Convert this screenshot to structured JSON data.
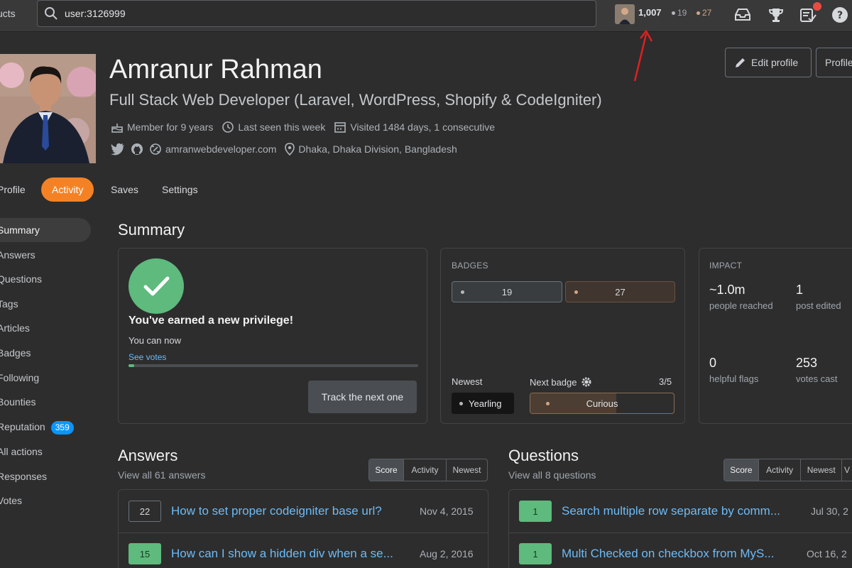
{
  "topbar": {
    "products_label": "ucts",
    "search_value": "user:3126999",
    "reputation": "1,007",
    "silver_count": "19",
    "bronze_count": "27"
  },
  "profile": {
    "name": "Amranur Rahman",
    "title": "Full Stack Web Developer (Laravel, WordPress, Shopify & CodeIgniter)",
    "member_for": "Member for 9 years",
    "last_seen": "Last seen this week",
    "visited": "Visited 1484 days, 1 consecutive",
    "website": "amranwebdeveloper.com",
    "location": "Dhaka, Dhaka Division, Bangladesh",
    "edit_profile_label": "Edit profile",
    "profiles_label": "Profile"
  },
  "tabs": [
    {
      "label": "Profile"
    },
    {
      "label": "Activity"
    },
    {
      "label": "Saves"
    },
    {
      "label": "Settings"
    }
  ],
  "sidebar": [
    {
      "label": "Summary"
    },
    {
      "label": "Answers"
    },
    {
      "label": "Questions"
    },
    {
      "label": "Tags"
    },
    {
      "label": "Articles"
    },
    {
      "label": "Badges"
    },
    {
      "label": "Following"
    },
    {
      "label": "Bounties"
    },
    {
      "label": "Reputation",
      "count": "359"
    },
    {
      "label": "All actions"
    },
    {
      "label": "Responses"
    },
    {
      "label": "Votes"
    }
  ],
  "summary": {
    "title": "Summary",
    "privilege": {
      "heading": "You've earned a new privilege!",
      "sub": "You can now",
      "link": "See votes",
      "progress": 0.02,
      "track_label": "Track the next one"
    },
    "badges": {
      "heading": "BADGES",
      "silver": "19",
      "bronze": "27",
      "newest_label": "Newest",
      "newest_badge": "Yearling",
      "next_label": "Next badge",
      "next_progress": "3/5",
      "next_badge": "Curious",
      "next_fraction": 0.6
    },
    "impact": {
      "heading": "IMPACT",
      "reached_value": "~1.0m",
      "reached_label": "people reached",
      "edited_value": "1",
      "edited_label": "post edited",
      "flags_value": "0",
      "flags_label": "helpful flags",
      "votes_value": "253",
      "votes_label": "votes cast"
    }
  },
  "answers": {
    "title": "Answers",
    "view_all": "View all 61 answers",
    "sort": [
      "Score",
      "Activity",
      "Newest"
    ],
    "rows": [
      {
        "score": "22",
        "title": "How to set proper codeigniter base url?",
        "date": "Nov 4, 2015",
        "accepted": false
      },
      {
        "score": "15",
        "title": "How can I show a hidden div when a se...",
        "date": "Aug 2, 2016",
        "accepted": true
      }
    ]
  },
  "questions": {
    "title": "Questions",
    "view_all": "View all 8 questions",
    "sort": [
      "Score",
      "Activity",
      "Newest",
      "V"
    ],
    "rows": [
      {
        "score": "1",
        "title": "Search multiple row separate by comm...",
        "date": "Jul 30, 2",
        "accepted": true
      },
      {
        "score": "1",
        "title": "Multi Checked on checkbox from MyS...",
        "date": "Oct 16, 2",
        "accepted": true
      }
    ]
  },
  "colors": {
    "accent": "#f48225",
    "link": "#6cbbf7",
    "green": "#5eba7d",
    "silver": "#b4b8bc",
    "bronze": "#d1a684",
    "annotation_arrow": "#e0201f"
  }
}
